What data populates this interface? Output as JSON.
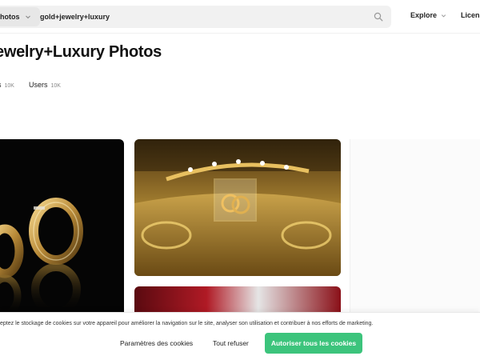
{
  "header": {
    "type_select_label": "hotos",
    "search_value": "gold+jewelry+luxury",
    "explore_label": "Explore",
    "license_label": "Licens"
  },
  "page": {
    "title": "ewelry+Luxury Photos"
  },
  "tabs": [
    {
      "label": "os",
      "count": "10K"
    },
    {
      "label": "Users",
      "count": "10K"
    }
  ],
  "photos": [
    {
      "subject": "gold hoop earrings on black background"
    },
    {
      "subject": "gold laurel tiara with rings in ornate gold box"
    },
    {
      "subject": "red and white fabric"
    }
  ],
  "cookie_banner": {
    "text": "eptez le stockage de cookies sur votre appareil pour améliorer la navigation sur le site, analyser son utilisation et contribuer à nos efforts de marketing.",
    "settings_label": "Paramètres des cookies",
    "refuse_label": "Tout refuser",
    "accept_label": "Autoriser tous les cookies",
    "accept_color": "#3cc47c"
  }
}
